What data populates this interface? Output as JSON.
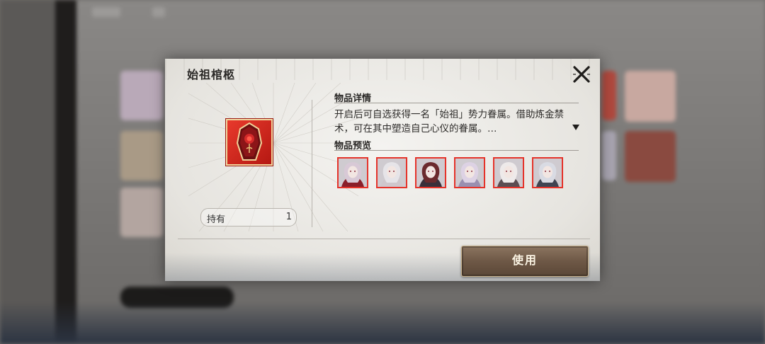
{
  "dialog": {
    "title": "始祖棺柩",
    "close_icon": "close-icon"
  },
  "item": {
    "icon": "coffin-rose-icon",
    "own_label": "持有",
    "own_count": "1"
  },
  "details": {
    "heading": "物品详情",
    "description": "开启后可自选获得一名「始祖」势力眷属。借助炼金禁术，可在其中塑造自己心仪的眷属。…",
    "expand_icon": "triangle-down-icon"
  },
  "preview": {
    "heading": "物品预览",
    "portraits": [
      {
        "name": "portrait-1",
        "hair": "#d8c9d6",
        "cloth": "#8a1f2a"
      },
      {
        "name": "portrait-2",
        "hair": "#e6e4e8",
        "cloth": "#cfc7cc"
      },
      {
        "name": "portrait-3",
        "hair": "#6b2a2e",
        "cloth": "#3a2f3a"
      },
      {
        "name": "portrait-4",
        "hair": "#ddd2e4",
        "cloth": "#9a8fb0"
      },
      {
        "name": "portrait-5",
        "hair": "#eeeaea",
        "cloth": "#5b4d52"
      },
      {
        "name": "portrait-6",
        "hair": "#d9dbe3",
        "cloth": "#3f4452"
      }
    ]
  },
  "actions": {
    "use_label": "使用"
  },
  "colors": {
    "accent_red": "#e5332a",
    "button_brown": "#6e5846"
  }
}
